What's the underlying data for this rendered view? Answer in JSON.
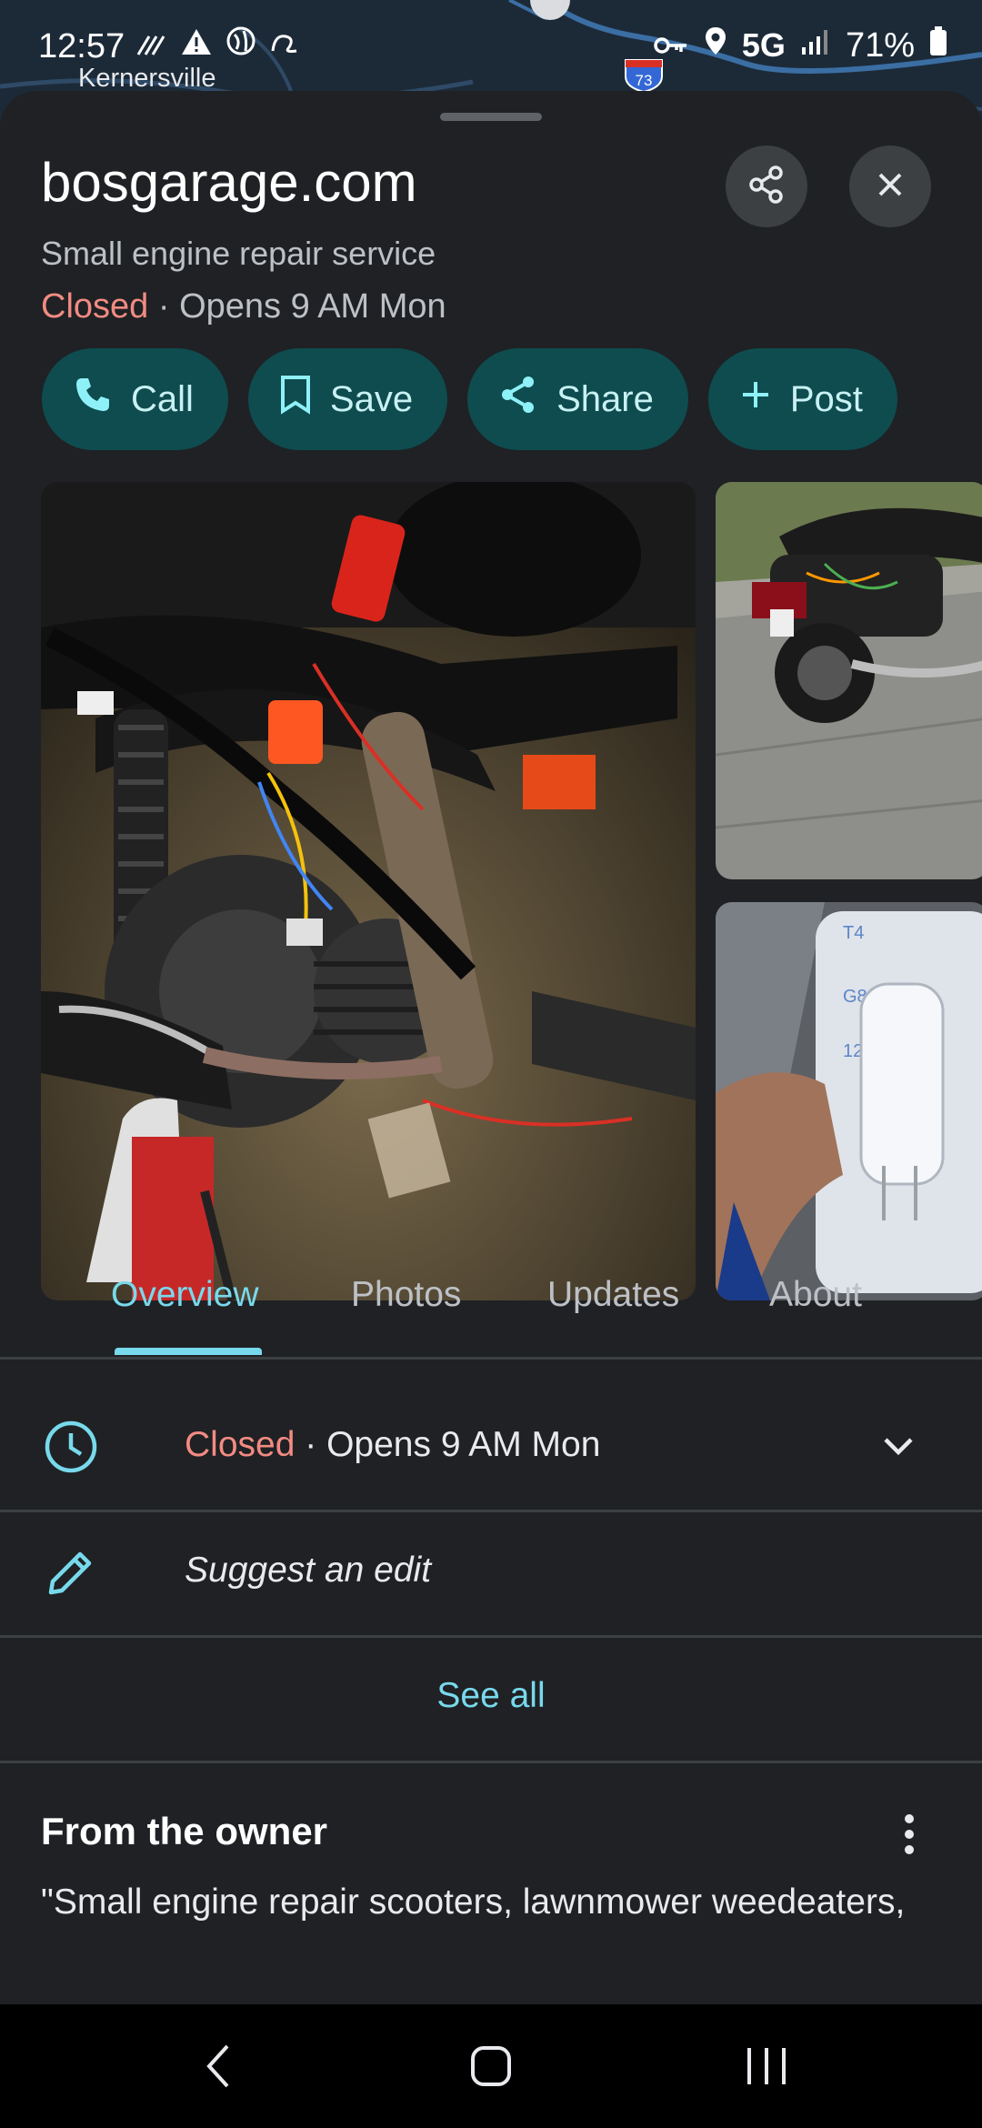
{
  "status_bar": {
    "time": "12:57",
    "network": "5G",
    "battery": "71%",
    "left_icons": [
      "wifi-calling-icon",
      "alert-icon",
      "vpn-globe-icon",
      "assistant-icon"
    ],
    "right_icons": [
      "key-icon",
      "location-icon",
      "signal-icon",
      "battery-icon"
    ]
  },
  "map": {
    "city_label": "Kernersville",
    "highway_number": "73"
  },
  "place": {
    "title": "bosgarage.com",
    "category": "Small engine repair service",
    "status": "Closed",
    "separator": " · ",
    "opens": "Opens 9 AM Mon"
  },
  "actions": [
    {
      "label": "Call",
      "icon": "phone-icon"
    },
    {
      "label": "Save",
      "icon": "bookmark-icon"
    },
    {
      "label": "Share",
      "icon": "share-icon"
    },
    {
      "label": "Post",
      "icon": "plus-icon"
    }
  ],
  "tabs": [
    "Overview",
    "Photos",
    "Updates",
    "About"
  ],
  "active_tab": "Overview",
  "hours_row": {
    "status": "Closed",
    "separator": " · ",
    "opens": "Opens 9 AM Mon"
  },
  "suggest_edit": "Suggest an edit",
  "see_all": "See all",
  "owner": {
    "title": "From the owner",
    "quote": "\"Small engine repair scooters, lawnmower weedeaters,"
  },
  "colors": {
    "accent": "#78d9ec",
    "closed": "#f28b82",
    "chip_bg": "#0e4c4f",
    "sheet_bg": "#1f2124"
  }
}
